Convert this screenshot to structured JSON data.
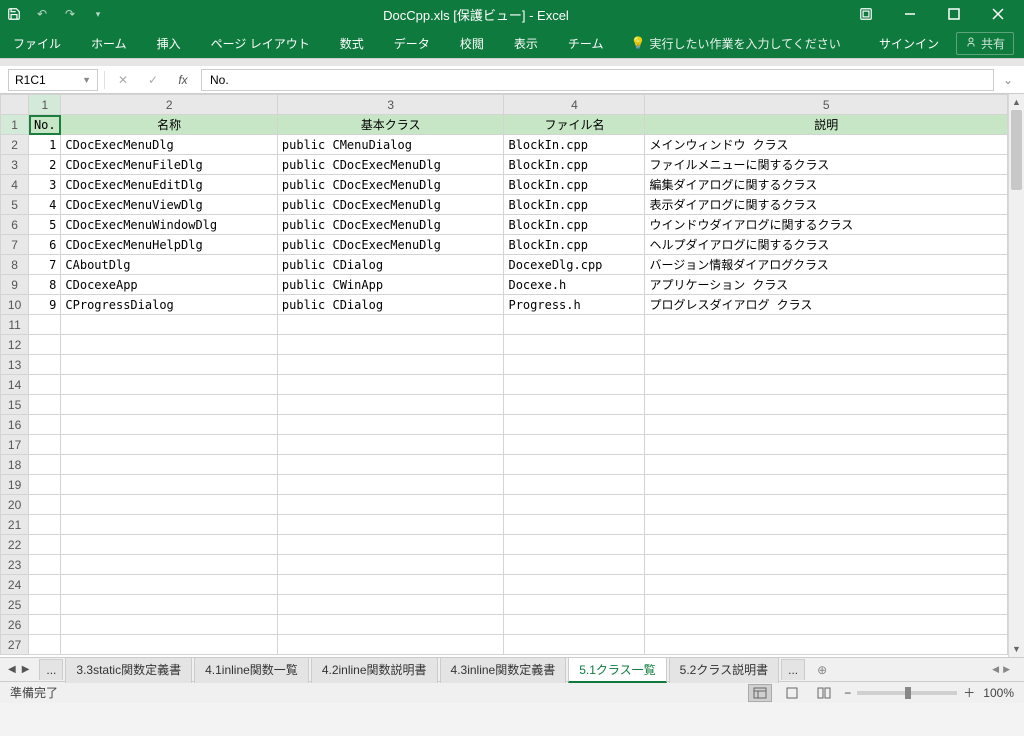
{
  "title": "DocCpp.xls  [保護ビュー] - Excel",
  "qat": {
    "save": "save",
    "undo": "undo",
    "redo": "redo"
  },
  "win": {
    "ribbon_opts": "",
    "min": "",
    "max": "",
    "close": ""
  },
  "ribbon": {
    "tabs": [
      "ファイル",
      "ホーム",
      "挿入",
      "ページ レイアウト",
      "数式",
      "データ",
      "校閲",
      "表示",
      "チーム"
    ],
    "tellme": "実行したい作業を入力してください",
    "signin": "サインイン",
    "share": "共有"
  },
  "formula_bar": {
    "name_box": "R1C1",
    "fx": "fx",
    "formula": "No."
  },
  "grid": {
    "col_headers": [
      "1",
      "2",
      "3",
      "4",
      "5"
    ],
    "row_headers": [
      "1",
      "2",
      "3",
      "4",
      "5",
      "6",
      "7",
      "8",
      "9",
      "10",
      "11",
      "12",
      "13",
      "14",
      "15",
      "16",
      "17",
      "18",
      "19",
      "20",
      "21",
      "22",
      "23",
      "24",
      "25",
      "26",
      "27"
    ],
    "table_headers": [
      "No.",
      "名称",
      "基本クラス",
      "ファイル名",
      "説明"
    ],
    "rows": [
      {
        "no": "1",
        "name": "CDocExecMenuDlg",
        "base": "public CMenuDialog",
        "file": "BlockIn.cpp",
        "desc": "メインウィンドウ クラス"
      },
      {
        "no": "2",
        "name": "CDocExecMenuFileDlg",
        "base": "public CDocExecMenuDlg",
        "file": "BlockIn.cpp",
        "desc": "ファイルメニューに関するクラス"
      },
      {
        "no": "3",
        "name": "CDocExecMenuEditDlg",
        "base": "public CDocExecMenuDlg",
        "file": "BlockIn.cpp",
        "desc": "編集ダイアログに関するクラス"
      },
      {
        "no": "4",
        "name": "CDocExecMenuViewDlg",
        "base": "public CDocExecMenuDlg",
        "file": "BlockIn.cpp",
        "desc": "表示ダイアログに関するクラス"
      },
      {
        "no": "5",
        "name": "CDocExecMenuWindowDlg",
        "base": "public CDocExecMenuDlg",
        "file": "BlockIn.cpp",
        "desc": "ウインドウダイアログに関するクラス"
      },
      {
        "no": "6",
        "name": "CDocExecMenuHelpDlg",
        "base": "public CDocExecMenuDlg",
        "file": "BlockIn.cpp",
        "desc": "ヘルプダイアログに関するクラス"
      },
      {
        "no": "7",
        "name": "CAboutDlg",
        "base": "public CDialog",
        "file": "DocexeDlg.cpp",
        "desc": "バージョン情報ダイアログクラス"
      },
      {
        "no": "8",
        "name": "CDocexeApp",
        "base": "public CWinApp",
        "file": "Docexe.h",
        "desc": "アプリケーション クラス"
      },
      {
        "no": "9",
        "name": "CProgressDialog",
        "base": "public CDialog",
        "file": "Progress.h",
        "desc": "プログレスダイアログ クラス"
      }
    ]
  },
  "sheet_tabs": {
    "ellipsis": "...",
    "tabs": [
      "3.3static関数定義書",
      "4.1inline関数一覧",
      "4.2inline関数説明書",
      "4.3inline関数定義書",
      "5.1クラス一覧",
      "5.2クラス説明書"
    ],
    "active_index": 4
  },
  "status": {
    "ready": "準備完了",
    "zoom": "100%"
  }
}
